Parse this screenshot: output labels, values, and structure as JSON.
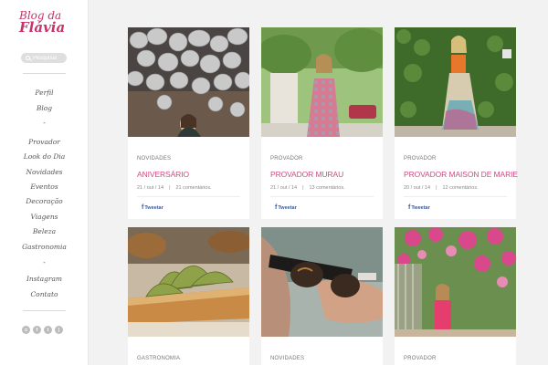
{
  "sidebar": {
    "logo": {
      "line1": "Blog da",
      "line2": "Flávia"
    },
    "search": {
      "placeholder": "Pesquisar"
    },
    "nav": {
      "items": [
        "Perfil",
        "Blog",
        "-",
        "Provador",
        "Look do Dia",
        "Novidades",
        "Eventos",
        "Decoração",
        "Viagens",
        "Beleza",
        "Gastronomia",
        "-",
        "Instagram",
        "Contato"
      ]
    },
    "social": [
      "instagram-icon",
      "facebook-icon",
      "twitter-icon",
      "rss-icon"
    ]
  },
  "posts": [
    {
      "category": "Novidades",
      "title": "ANIVERSÁRIO",
      "date": "21 / out / 14",
      "comments": "21 comentários.",
      "share": "Tweetar",
      "image": "balloons-photo"
    },
    {
      "category": "Provador",
      "title": "PROVADOR MURAU",
      "date": "21 / out / 14",
      "comments": "13 comentários.",
      "share": "Tweetar",
      "image": "floral-dress-photo"
    },
    {
      "category": "Provador",
      "title": "PROVADOR MAISON DE MARIE",
      "date": "20 / out / 14",
      "comments": "12 comentários.",
      "share": "Tweetar",
      "image": "ivy-wall-photo"
    },
    {
      "category": "Gastronomia",
      "title": "",
      "date": "",
      "comments": "",
      "share": "",
      "image": "food-photo"
    },
    {
      "category": "Novidades",
      "title": "",
      "date": "",
      "comments": "",
      "share": "",
      "image": "sunglasses-photo"
    },
    {
      "category": "Provador",
      "title": "",
      "date": "",
      "comments": "",
      "share": "",
      "image": "flowers-photo"
    }
  ],
  "colors": {
    "brand": "#c8326b",
    "title": "#d14a82",
    "background": "#f2f2f2"
  }
}
